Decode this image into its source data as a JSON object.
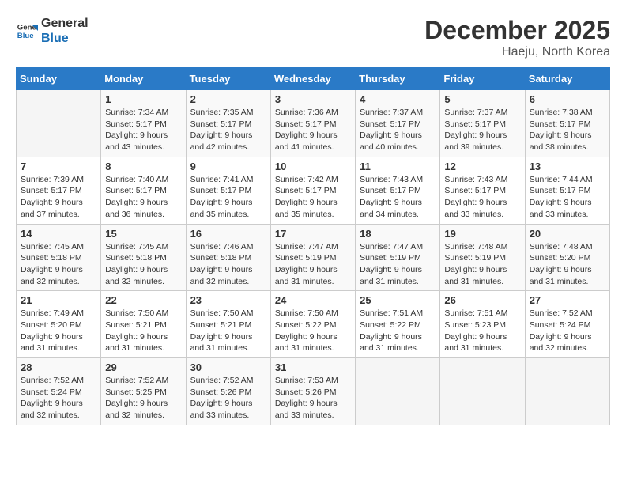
{
  "logo": {
    "line1": "General",
    "line2": "Blue"
  },
  "title": "December 2025",
  "location": "Haeju, North Korea",
  "days_header": [
    "Sunday",
    "Monday",
    "Tuesday",
    "Wednesday",
    "Thursday",
    "Friday",
    "Saturday"
  ],
  "weeks": [
    [
      {
        "day": "",
        "info": ""
      },
      {
        "day": "1",
        "info": "Sunrise: 7:34 AM\nSunset: 5:17 PM\nDaylight: 9 hours\nand 43 minutes."
      },
      {
        "day": "2",
        "info": "Sunrise: 7:35 AM\nSunset: 5:17 PM\nDaylight: 9 hours\nand 42 minutes."
      },
      {
        "day": "3",
        "info": "Sunrise: 7:36 AM\nSunset: 5:17 PM\nDaylight: 9 hours\nand 41 minutes."
      },
      {
        "day": "4",
        "info": "Sunrise: 7:37 AM\nSunset: 5:17 PM\nDaylight: 9 hours\nand 40 minutes."
      },
      {
        "day": "5",
        "info": "Sunrise: 7:37 AM\nSunset: 5:17 PM\nDaylight: 9 hours\nand 39 minutes."
      },
      {
        "day": "6",
        "info": "Sunrise: 7:38 AM\nSunset: 5:17 PM\nDaylight: 9 hours\nand 38 minutes."
      }
    ],
    [
      {
        "day": "7",
        "info": "Sunrise: 7:39 AM\nSunset: 5:17 PM\nDaylight: 9 hours\nand 37 minutes."
      },
      {
        "day": "8",
        "info": "Sunrise: 7:40 AM\nSunset: 5:17 PM\nDaylight: 9 hours\nand 36 minutes."
      },
      {
        "day": "9",
        "info": "Sunrise: 7:41 AM\nSunset: 5:17 PM\nDaylight: 9 hours\nand 35 minutes."
      },
      {
        "day": "10",
        "info": "Sunrise: 7:42 AM\nSunset: 5:17 PM\nDaylight: 9 hours\nand 35 minutes."
      },
      {
        "day": "11",
        "info": "Sunrise: 7:43 AM\nSunset: 5:17 PM\nDaylight: 9 hours\nand 34 minutes."
      },
      {
        "day": "12",
        "info": "Sunrise: 7:43 AM\nSunset: 5:17 PM\nDaylight: 9 hours\nand 33 minutes."
      },
      {
        "day": "13",
        "info": "Sunrise: 7:44 AM\nSunset: 5:17 PM\nDaylight: 9 hours\nand 33 minutes."
      }
    ],
    [
      {
        "day": "14",
        "info": "Sunrise: 7:45 AM\nSunset: 5:18 PM\nDaylight: 9 hours\nand 32 minutes."
      },
      {
        "day": "15",
        "info": "Sunrise: 7:45 AM\nSunset: 5:18 PM\nDaylight: 9 hours\nand 32 minutes."
      },
      {
        "day": "16",
        "info": "Sunrise: 7:46 AM\nSunset: 5:18 PM\nDaylight: 9 hours\nand 32 minutes."
      },
      {
        "day": "17",
        "info": "Sunrise: 7:47 AM\nSunset: 5:19 PM\nDaylight: 9 hours\nand 31 minutes."
      },
      {
        "day": "18",
        "info": "Sunrise: 7:47 AM\nSunset: 5:19 PM\nDaylight: 9 hours\nand 31 minutes."
      },
      {
        "day": "19",
        "info": "Sunrise: 7:48 AM\nSunset: 5:19 PM\nDaylight: 9 hours\nand 31 minutes."
      },
      {
        "day": "20",
        "info": "Sunrise: 7:48 AM\nSunset: 5:20 PM\nDaylight: 9 hours\nand 31 minutes."
      }
    ],
    [
      {
        "day": "21",
        "info": "Sunrise: 7:49 AM\nSunset: 5:20 PM\nDaylight: 9 hours\nand 31 minutes."
      },
      {
        "day": "22",
        "info": "Sunrise: 7:50 AM\nSunset: 5:21 PM\nDaylight: 9 hours\nand 31 minutes."
      },
      {
        "day": "23",
        "info": "Sunrise: 7:50 AM\nSunset: 5:21 PM\nDaylight: 9 hours\nand 31 minutes."
      },
      {
        "day": "24",
        "info": "Sunrise: 7:50 AM\nSunset: 5:22 PM\nDaylight: 9 hours\nand 31 minutes."
      },
      {
        "day": "25",
        "info": "Sunrise: 7:51 AM\nSunset: 5:22 PM\nDaylight: 9 hours\nand 31 minutes."
      },
      {
        "day": "26",
        "info": "Sunrise: 7:51 AM\nSunset: 5:23 PM\nDaylight: 9 hours\nand 31 minutes."
      },
      {
        "day": "27",
        "info": "Sunrise: 7:52 AM\nSunset: 5:24 PM\nDaylight: 9 hours\nand 32 minutes."
      }
    ],
    [
      {
        "day": "28",
        "info": "Sunrise: 7:52 AM\nSunset: 5:24 PM\nDaylight: 9 hours\nand 32 minutes."
      },
      {
        "day": "29",
        "info": "Sunrise: 7:52 AM\nSunset: 5:25 PM\nDaylight: 9 hours\nand 32 minutes."
      },
      {
        "day": "30",
        "info": "Sunrise: 7:52 AM\nSunset: 5:26 PM\nDaylight: 9 hours\nand 33 minutes."
      },
      {
        "day": "31",
        "info": "Sunrise: 7:53 AM\nSunset: 5:26 PM\nDaylight: 9 hours\nand 33 minutes."
      },
      {
        "day": "",
        "info": ""
      },
      {
        "day": "",
        "info": ""
      },
      {
        "day": "",
        "info": ""
      }
    ]
  ]
}
